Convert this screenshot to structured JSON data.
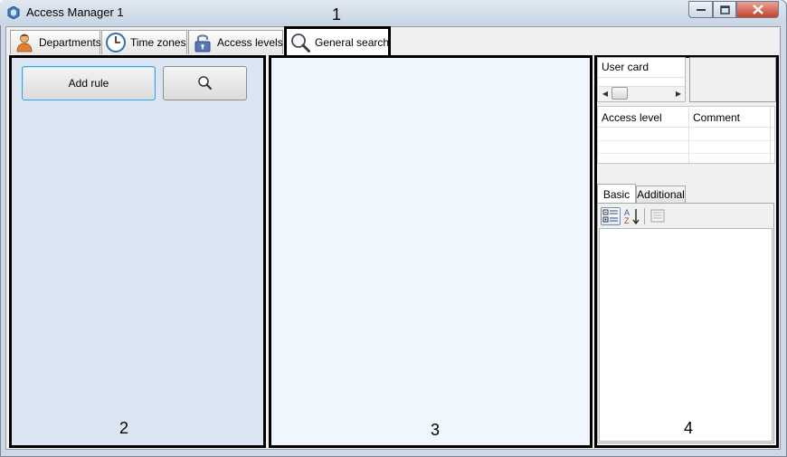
{
  "window": {
    "title": "Access Manager 1",
    "min_symbol": "▁",
    "max_symbol": "□",
    "close_symbol": "✕"
  },
  "tabs": [
    {
      "label": "Departments",
      "icon": "person-icon"
    },
    {
      "label": "Time zones",
      "icon": "clock-icon"
    },
    {
      "label": "Access levels",
      "icon": "padlock-icon"
    },
    {
      "label": "General search",
      "icon": "magnifier-icon",
      "selected": true
    }
  ],
  "annotations": {
    "n1": "1",
    "n2": "2",
    "n3": "3",
    "n4": "4"
  },
  "left_panel": {
    "add_rule_label": "Add rule",
    "search_icon": "magnifier-icon"
  },
  "right_panel": {
    "user_card_label": "User card",
    "grid_headers": [
      "Access level",
      "Comment"
    ],
    "property_tabs": [
      "Basic",
      "Additional"
    ],
    "sort_label_top": "A",
    "sort_label_bottom": "Z"
  },
  "colors": {
    "panel2_bg": "#dbe6f2",
    "panel3_bg": "#eff6fd",
    "close_red": "#c4412d",
    "focus_blue": "#3d9fd6"
  }
}
